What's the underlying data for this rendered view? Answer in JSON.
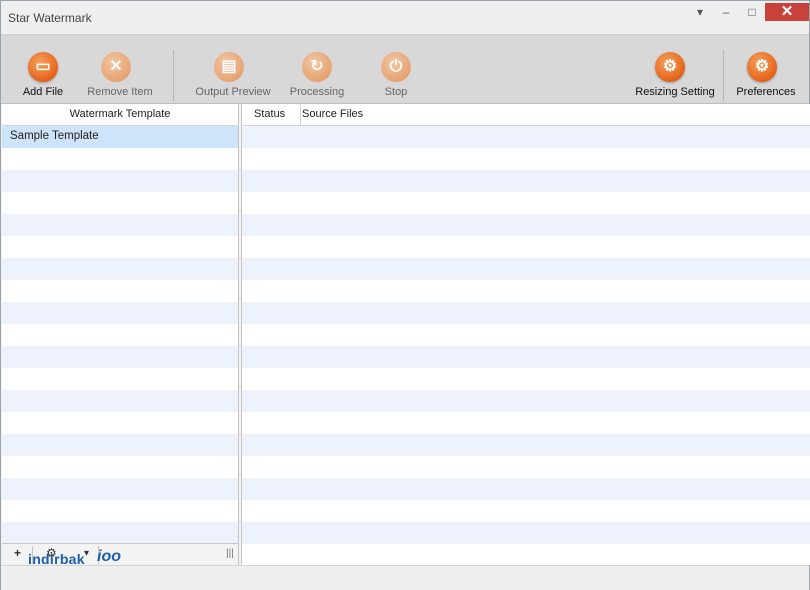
{
  "window": {
    "title": "Star Watermark"
  },
  "toolbar": {
    "add_file": "Add File",
    "remove_item": "Remove Item",
    "output_preview": "Output Preview",
    "processing": "Processing",
    "stop": "Stop",
    "resizing_setting": "Resizing Setting",
    "preferences": "Preferences"
  },
  "left_panel": {
    "header": "Watermark Template",
    "items": [
      {
        "label": "Sample Template"
      }
    ]
  },
  "right_panel": {
    "columns": [
      "Status",
      "Source Files"
    ]
  },
  "bottom_bar": {
    "add": "+",
    "settings": "⚙",
    "menu": "▾",
    "grip": "|||"
  },
  "watermark": {
    "text": "indirbak",
    "mark": "ioo"
  },
  "colors": {
    "accent": "#e4631c",
    "selected_row": "#cde4fb",
    "alt_row": "#eef2fc"
  }
}
